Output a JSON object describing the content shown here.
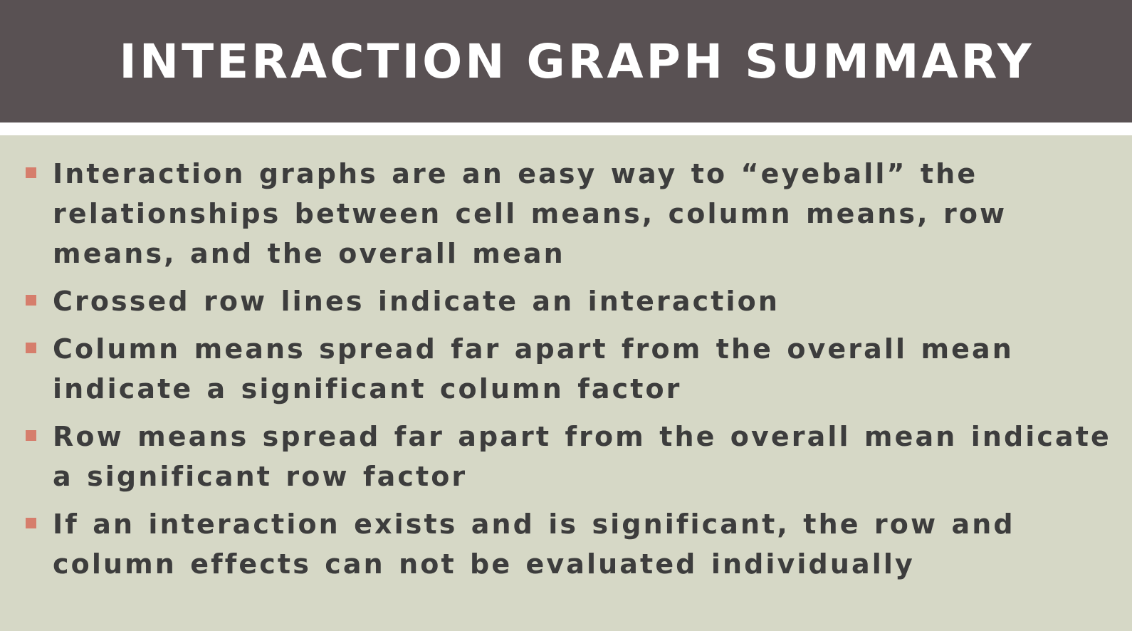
{
  "slide": {
    "title": "INTERACTION GRAPH SUMMARY",
    "bullets": [
      {
        "text": "Interaction graphs are an easy way to “eyeball” the relationships between cell means, column means, row means, and the overall mean",
        "marker_icon": "square-bullet-icon"
      },
      {
        "text": "Crossed row lines indicate an interaction",
        "marker_icon": "square-bullet-icon"
      },
      {
        "text": "Column means spread far apart from the overall mean indicate a significant column factor",
        "marker_icon": "square-bullet-icon"
      },
      {
        "text": "Row means spread far apart from the overall mean indicate a significant row factor",
        "marker_icon": "square-bullet-icon"
      },
      {
        "text": "If an interaction exists and is significant, the row and column effects can not be evaluated individually",
        "marker_icon": "square-bullet-icon"
      }
    ]
  },
  "colors": {
    "title_bar": "#595153",
    "title_text": "#ffffff",
    "content_background": "#d6d8c6",
    "body_text": "#3d3d3d",
    "bullet_marker": "#d67e6c"
  }
}
